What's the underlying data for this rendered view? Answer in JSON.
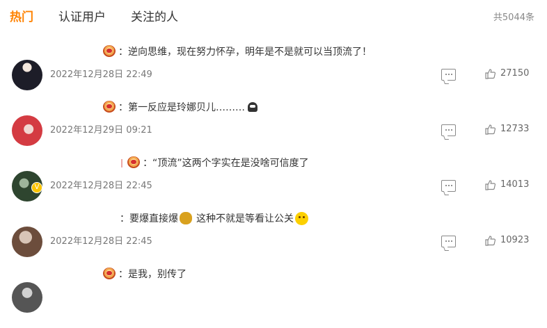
{
  "tabs": [
    {
      "label": "热门",
      "active": true
    },
    {
      "label": "认证用户",
      "active": false
    },
    {
      "label": "关注的人",
      "active": false
    }
  ],
  "total_label": "共5044条",
  "comments": [
    {
      "text": "：逆向思维，现在努力怀孕，明年是不是就可以当顶流了！",
      "time": "2022年12月28日 22:49",
      "likes": "27150",
      "avatar_color": "#2f2f3d"
    },
    {
      "text": "：第一反应是玲娜贝儿………",
      "time": "2022年12月29日 09:21",
      "likes": "12733",
      "avatar_color": "#c9303a"
    },
    {
      "text": "：“顶流”这两个字实在是没啥可信度了",
      "time": "2022年12月28日 22:45",
      "likes": "14013",
      "avatar_color": "#3f5a3a"
    },
    {
      "text_before": "：要爆直接爆",
      "text_after": "这种不就是等看让公关",
      "time": "2022年12月28日 22:45",
      "likes": "10923",
      "avatar_color": "#7a5a48"
    },
    {
      "text": "：是我，别传了",
      "avatar_color": "#6d6d6d"
    }
  ],
  "icons": {
    "reply": "comment-icon",
    "like": "thumbs-up-icon",
    "medal": "fan-medal-icon",
    "verified": "verified-badge-icon"
  },
  "colors": {
    "accent": "#ff8200",
    "muted": "#777777"
  }
}
